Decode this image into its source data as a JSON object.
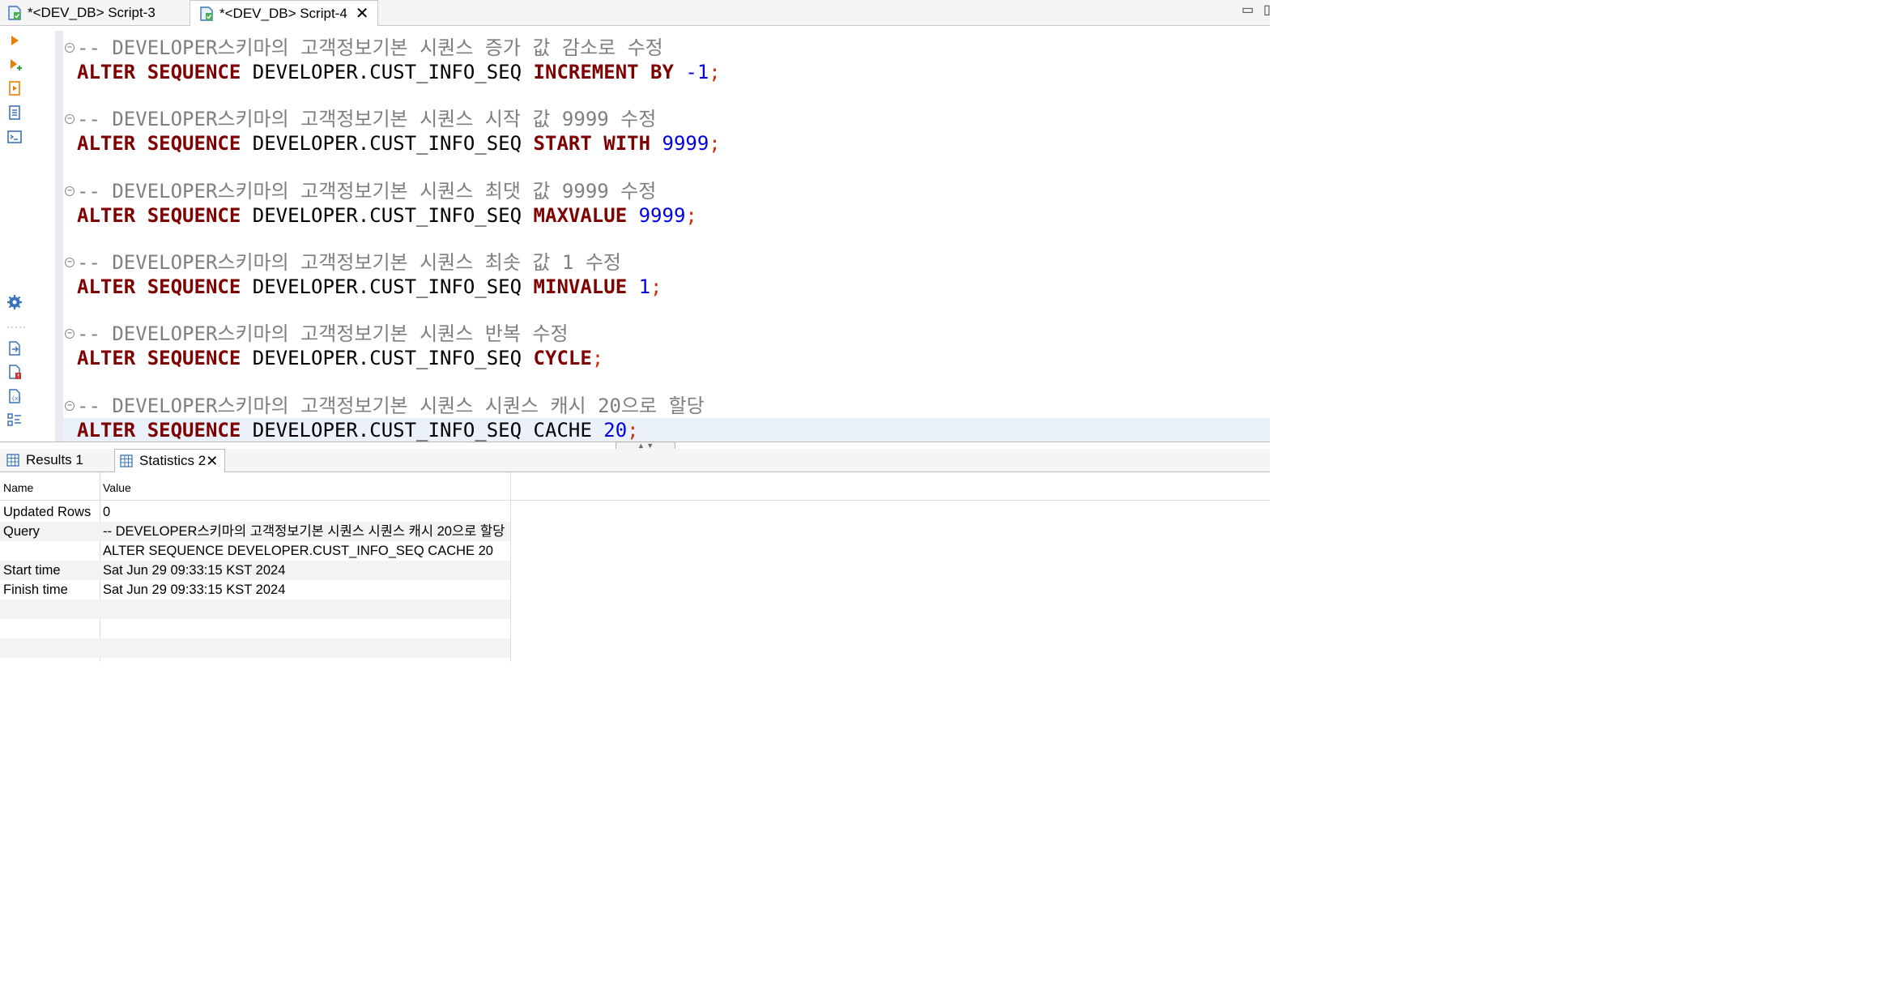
{
  "tabs": [
    {
      "label": "*<DEV_DB> Script-3",
      "active": false
    },
    {
      "label": "*<DEV_DB> Script-4",
      "active": true
    }
  ],
  "editor": {
    "blocks": [
      {
        "comment": "-- DEVELOPER스키마의 고객정보기본 시퀀스 증가 값 감소로 수정",
        "sql": {
          "k1": "ALTER",
          "k2": "SEQUENCE",
          "obj": "DEVELOPER.CUST_INFO_SEQ",
          "clause": "INCREMENT BY",
          "value": "-1",
          "semi": ";"
        }
      },
      {
        "comment": "-- DEVELOPER스키마의 고객정보기본 시퀀스 시작 값 9999 수정",
        "sql": {
          "k1": "ALTER",
          "k2": "SEQUENCE",
          "obj": "DEVELOPER.CUST_INFO_SEQ",
          "clause": "START WITH",
          "value": "9999",
          "semi": ";"
        }
      },
      {
        "comment": "-- DEVELOPER스키마의 고객정보기본 시퀀스 최댓 값 9999 수정",
        "sql": {
          "k1": "ALTER",
          "k2": "SEQUENCE",
          "obj": "DEVELOPER.CUST_INFO_SEQ",
          "clause": "MAXVALUE",
          "value": "9999",
          "semi": ";"
        }
      },
      {
        "comment": "-- DEVELOPER스키마의 고객정보기본 시퀀스 최솟 값 1 수정",
        "sql": {
          "k1": "ALTER",
          "k2": "SEQUENCE",
          "obj": "DEVELOPER.CUST_INFO_SEQ",
          "clause": "MINVALUE",
          "value": "1",
          "semi": ";"
        }
      },
      {
        "comment": "-- DEVELOPER스키마의 고객정보기본 시퀀스 반복 수정",
        "sql": {
          "k1": "ALTER",
          "k2": "SEQUENCE",
          "obj": "DEVELOPER.CUST_INFO_SEQ",
          "clause": "CYCLE",
          "value": "",
          "semi": ";"
        }
      },
      {
        "comment": "-- DEVELOPER스키마의 고객정보기본 시퀀스 시퀀스 캐시 20으로 할당",
        "sql": {
          "k1": "ALTER",
          "k2": "SEQUENCE",
          "obj": "DEVELOPER.CUST_INFO_SEQ",
          "clause": "CACHE",
          "value": "20",
          "semi": ";"
        }
      }
    ]
  },
  "results": {
    "tabs": [
      {
        "label": "Results 1",
        "active": false
      },
      {
        "label": "Statistics 2",
        "active": true
      }
    ],
    "columns": [
      "Name",
      "Value"
    ],
    "rows": [
      {
        "name": "Updated Rows",
        "value": "0"
      },
      {
        "name": "Query",
        "value": "-- DEVELOPER스키마의 고객정보기본 시퀀스 시퀀스 캐시 20으로 할당"
      },
      {
        "name": "",
        "value": "ALTER SEQUENCE DEVELOPER.CUST_INFO_SEQ CACHE 20"
      },
      {
        "name": "Start time",
        "value": "Sat Jun 29 09:33:15 KST 2024"
      },
      {
        "name": "Finish time",
        "value": "Sat Jun 29 09:33:15 KST 2024"
      }
    ]
  },
  "colors": {
    "keyword": "#7f0000",
    "comment": "#7f7f7f",
    "number": "#0000e0",
    "semicolon": "#d0300f",
    "current_line": "#eaf1fb"
  },
  "icons": {
    "script_tab": "sql-script-icon",
    "grid_tab": "grid-table-icon"
  }
}
